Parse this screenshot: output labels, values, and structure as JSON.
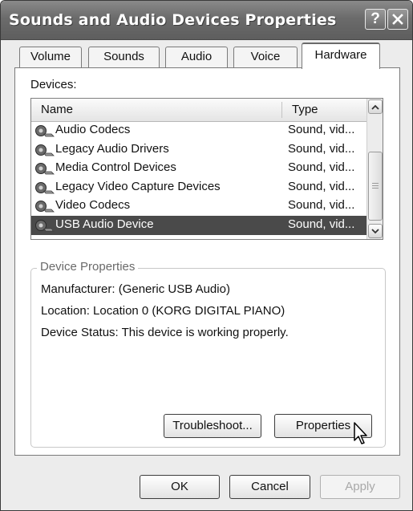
{
  "window": {
    "title": "Sounds and Audio Devices Properties",
    "help_glyph": "?",
    "close_glyph": "close"
  },
  "tabs": [
    {
      "label": "Volume",
      "active": false
    },
    {
      "label": "Sounds",
      "active": false
    },
    {
      "label": "Audio",
      "active": false
    },
    {
      "label": "Voice",
      "active": false
    },
    {
      "label": "Hardware",
      "active": true
    }
  ],
  "devices": {
    "label": "Devices:",
    "columns": {
      "name": "Name",
      "type": "Type"
    },
    "rows": [
      {
        "name": "Audio Codecs",
        "type": "Sound, vid...",
        "icon": "speaker-device-icon"
      },
      {
        "name": "Legacy Audio Drivers",
        "type": "Sound, vid...",
        "icon": "speaker-device-icon"
      },
      {
        "name": "Media Control Devices",
        "type": "Sound, vid...",
        "icon": "speaker-device-icon"
      },
      {
        "name": "Legacy Video Capture Devices",
        "type": "Sound, vid...",
        "icon": "speaker-device-icon"
      },
      {
        "name": "Video Codecs",
        "type": "Sound, vid...",
        "icon": "speaker-device-icon"
      },
      {
        "name": "USB Audio Device",
        "type": "Sound, vid...",
        "icon": "speaker-device-icon",
        "selected": true
      }
    ]
  },
  "device_properties": {
    "title": "Device Properties",
    "manufacturer": "Manufacturer: (Generic USB Audio)",
    "location": "Location: Location 0 (KORG DIGITAL PIANO)",
    "status": "Device Status: This device is working properly.",
    "troubleshoot_label": "Troubleshoot...",
    "properties_label": "Properties"
  },
  "footer": {
    "ok_label": "OK",
    "cancel_label": "Cancel",
    "apply_label": "Apply"
  },
  "colors": {
    "titlebar": "#6b6b6b",
    "selection": "#4a4a4a",
    "window_bg": "#ececec"
  }
}
